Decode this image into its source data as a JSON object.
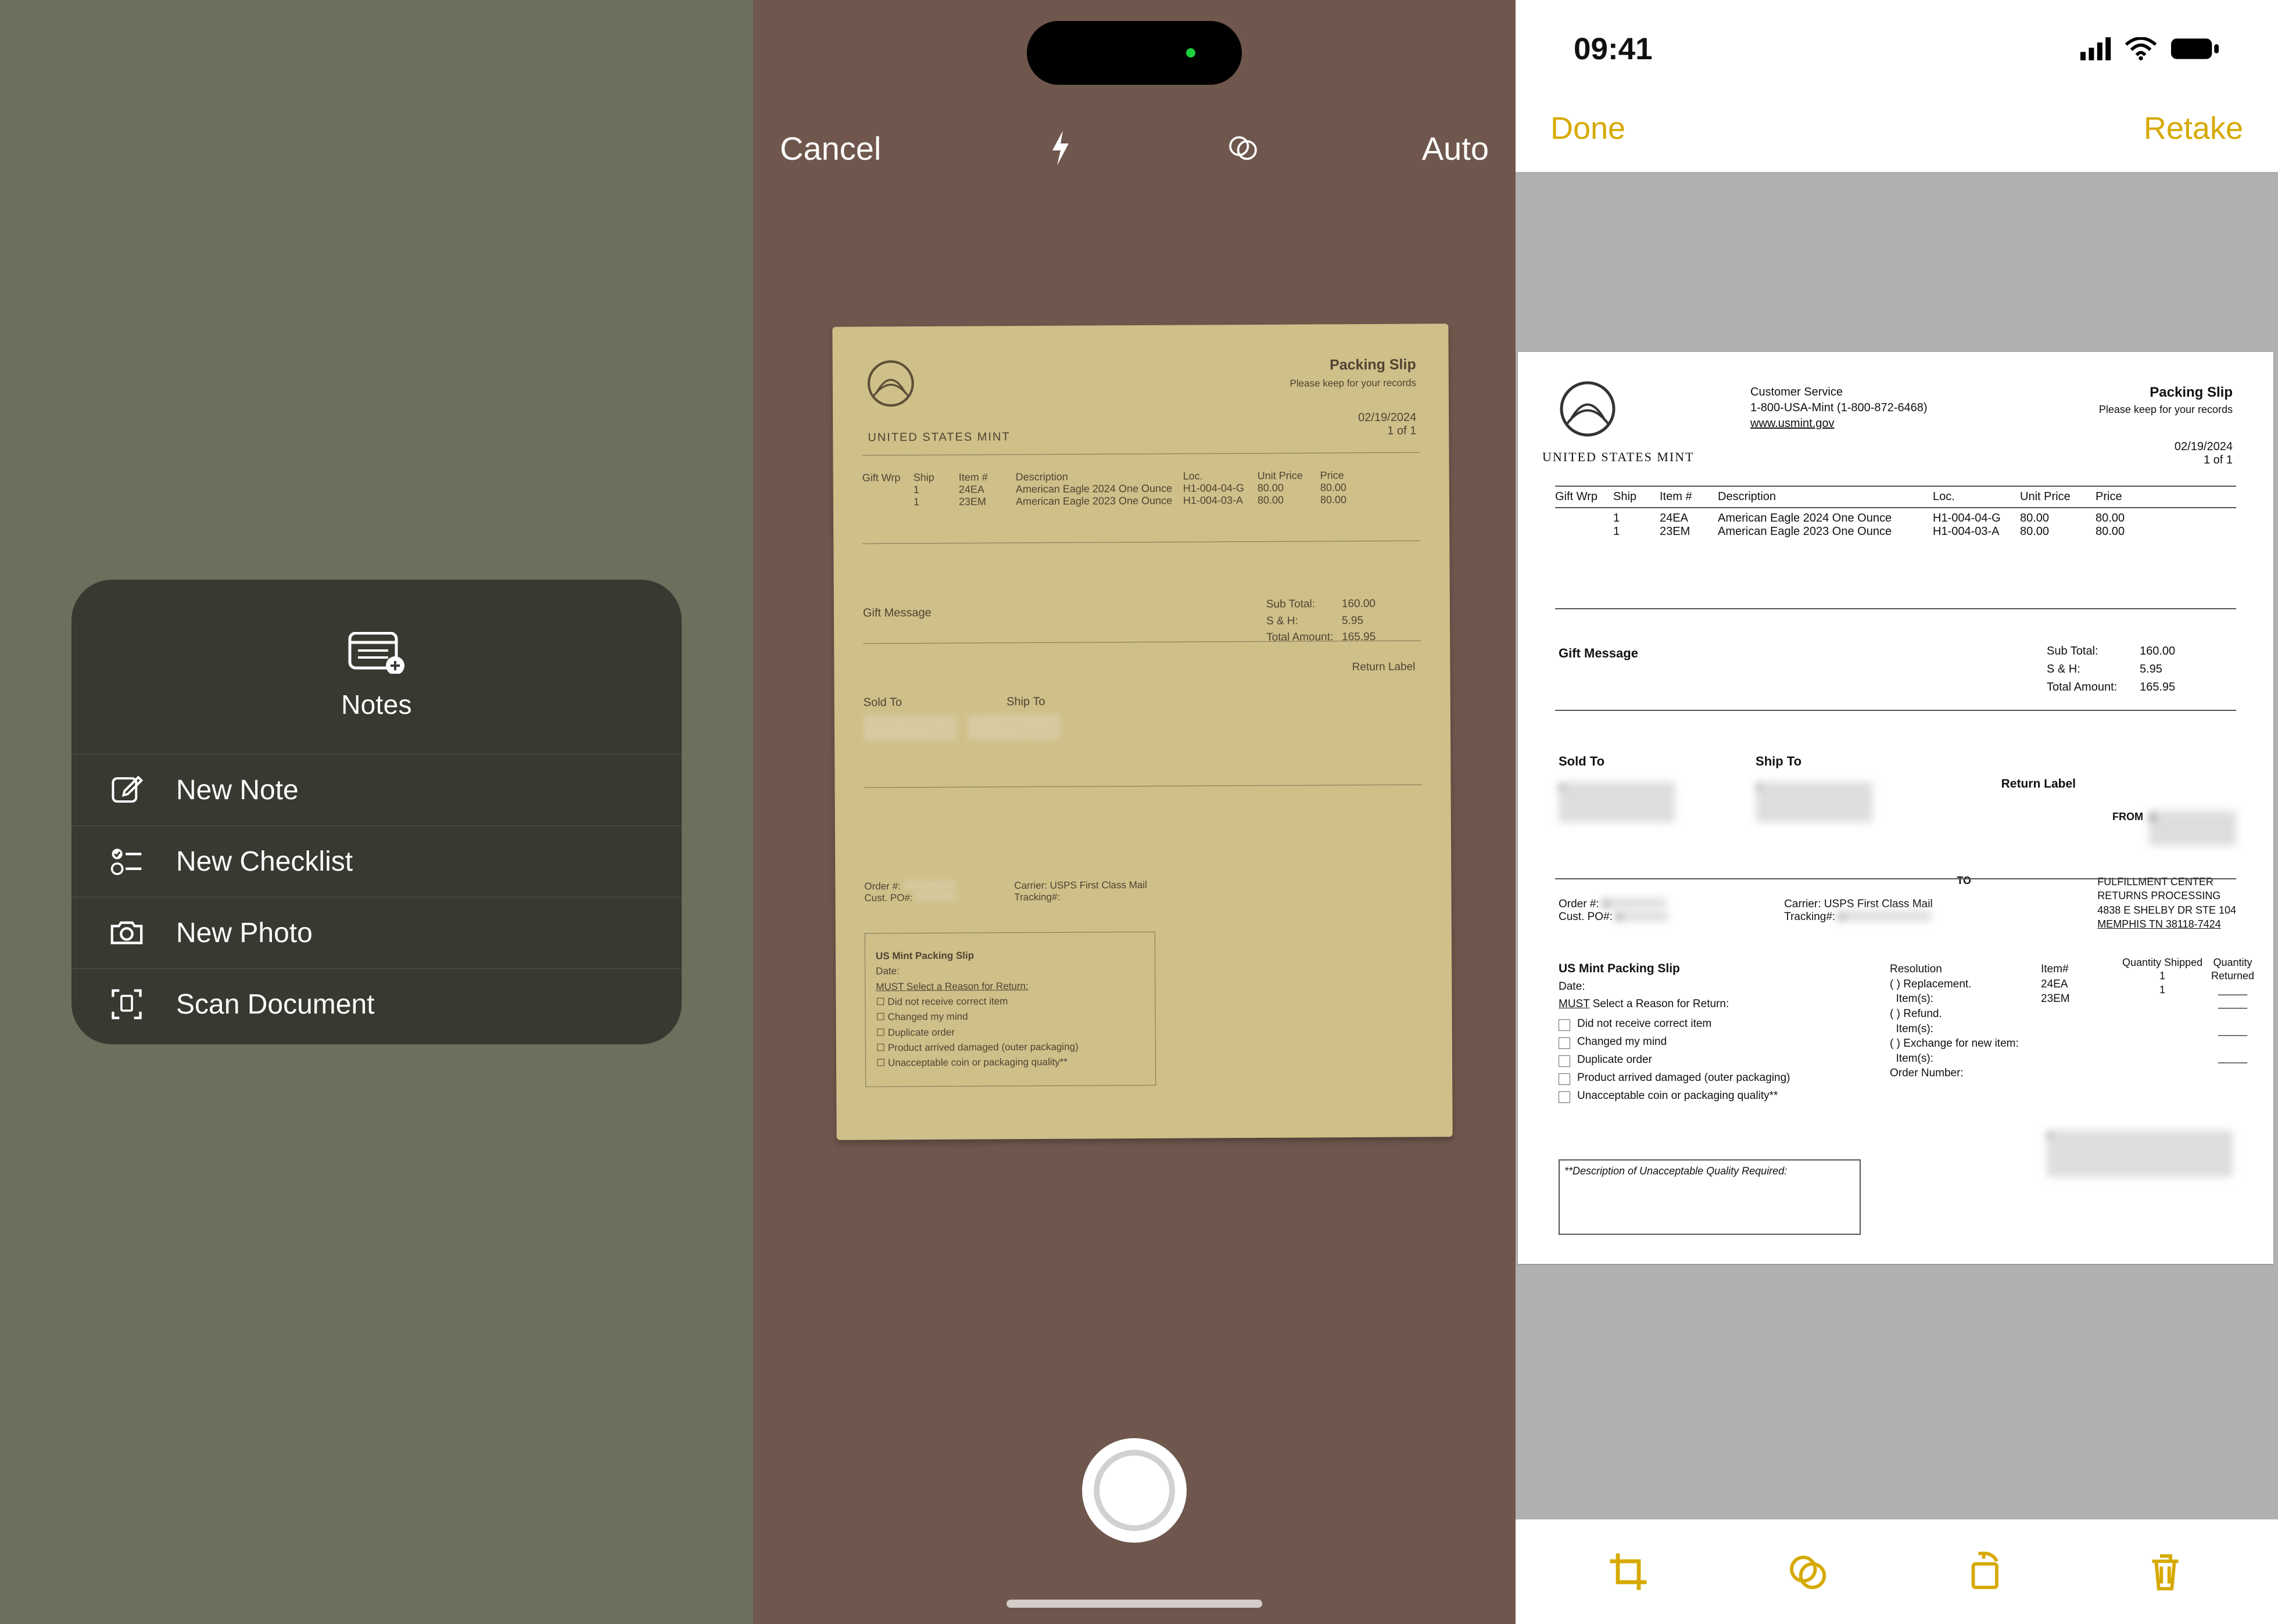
{
  "panel1": {
    "menu_title": "Notes",
    "items": [
      {
        "label": "New Note"
      },
      {
        "label": "New Checklist"
      },
      {
        "label": "New Photo"
      },
      {
        "label": "Scan Document"
      }
    ]
  },
  "panel2": {
    "cancel": "Cancel",
    "auto": "Auto"
  },
  "document": {
    "brand": "UNITED STATES MINT",
    "customer_service": "Customer Service",
    "phone": "1-800-USA-Mint (1-800-872-6468)",
    "website": "www.usmint.gov",
    "slip_title": "Packing Slip",
    "slip_sub": "Please keep for your records",
    "date": "02/19/2024",
    "page": "1 of 1",
    "headers": {
      "giftwrp": "Gift Wrp",
      "ship": "Ship",
      "item": "Item #",
      "desc": "Description",
      "loc": "Loc.",
      "uprice": "Unit Price",
      "price": "Price"
    },
    "rows": [
      {
        "giftwrp": "",
        "ship": "1",
        "item": "24EA",
        "desc": "American Eagle 2024 One Ounce",
        "loc": "H1-004-04-G",
        "uprice": "80.00",
        "price": "80.00"
      },
      {
        "giftwrp": "",
        "ship": "1",
        "item": "23EM",
        "desc": "American Eagle 2023 One Ounce",
        "loc": "H1-004-03-A",
        "uprice": "80.00",
        "price": "80.00"
      }
    ],
    "gift_message": "Gift Message",
    "totals": {
      "sub": "Sub Total:",
      "sub_v": "160.00",
      "sh": "S & H:",
      "sh_v": "5.95",
      "tot": "Total Amount:",
      "tot_v": "165.95"
    },
    "sold_to": "Sold To",
    "ship_to": "Ship To",
    "return_label": "Return Label",
    "from": "FROM",
    "to": "TO",
    "fulfill": [
      "FULFILLMENT CENTER",
      "RETURNS PROCESSING",
      "4838 E SHELBY DR STE 104",
      "MEMPHIS TN  38118-7424"
    ],
    "order": "Order #:",
    "cust": "Cust. PO#:",
    "carrier": "Carrier: USPS First Class Mail",
    "tracking": "Tracking#:",
    "returns": {
      "title": "US Mint Packing Slip",
      "date": "Date:",
      "must": "MUST Select a Reason for Return:",
      "opts": [
        "Did not receive correct item",
        "Changed my mind",
        "Duplicate order",
        "Product arrived damaged (outer packaging)",
        "Unacceptable coin or packaging quality**"
      ],
      "resolution": "Resolution",
      "replacement": "( ) Replacement.",
      "refund": "( ) Refund.",
      "exchange": "( ) Exchange for new item:",
      "items": "Item(s):",
      "item_h": "Item#",
      "qship": "Quantity Shipped",
      "qret": "Quantity Returned",
      "r1": "24EA",
      "r2": "23EM",
      "q1": "1",
      "q2": "1",
      "on": "Order Number:",
      "desc_label": "**Description of Unacceptable Quality Required:"
    }
  },
  "panel3": {
    "time": "09:41",
    "done": "Done",
    "retake": "Retake"
  }
}
